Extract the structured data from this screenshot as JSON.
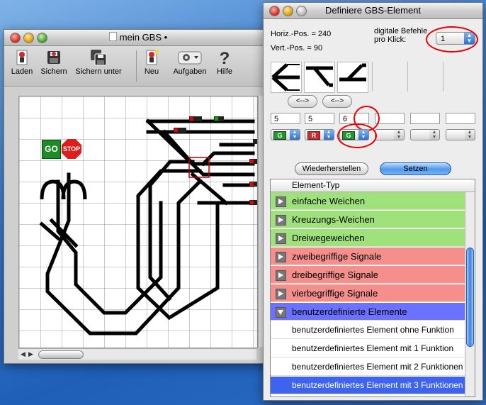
{
  "main_window": {
    "title": "mein GBS",
    "title_dot": "•",
    "toolbar": {
      "laden": "Laden",
      "sichern": "Sichern",
      "sichern_unter": "Sichern unter",
      "neu": "Neu",
      "aufgaben": "Aufgaben",
      "hilfe": "Hilfe"
    },
    "canvas": {
      "go_label": "GO",
      "stop_label": "STOP"
    }
  },
  "dialog": {
    "title": "Definiere GBS-Element",
    "horiz_pos": "Horiz.-Pos. = 240",
    "vert_pos": "Vert.-Pos. = 90",
    "digital_label_line1": "digitale Befehle",
    "digital_label_line2": "pro Klick:",
    "digital_value": "1",
    "swap_label": "<-->",
    "fields": [
      "5",
      "5",
      "6",
      "",
      "",
      ""
    ],
    "signals": [
      {
        "label": "G",
        "color": "#1e9a2a"
      },
      {
        "label": "R",
        "color": "#d9262a"
      },
      {
        "label": "G",
        "color": "#1e9a2a"
      }
    ],
    "btn_restore": "Wiederherstellen",
    "btn_set": "Setzen",
    "list_header": "Element-Typ",
    "categories": [
      {
        "label": "einfache Weichen",
        "color": "green"
      },
      {
        "label": "Kreuzungs-Weichen",
        "color": "green"
      },
      {
        "label": "Dreiwegeweichen",
        "color": "green"
      },
      {
        "label": "zweibegriffige Signale",
        "color": "red"
      },
      {
        "label": "dreibegriffige Signale",
        "color": "red"
      },
      {
        "label": "vierbegriffige Signale",
        "color": "red"
      },
      {
        "label": "benutzerdefinierte Elemente",
        "color": "blue"
      }
    ],
    "items": [
      "benutzerdefiniertes Element ohne Funktion",
      "benutzerdefiniertes Element mit 1 Funktion",
      "benutzerdefiniertes Element mit 2 Funktionen",
      "benutzerdefiniertes Element mit 3 Funktionen"
    ]
  },
  "colors": {
    "highlight_red": "#e00000",
    "selection_blue": "#3e63ee",
    "category_green": "#9fe27b",
    "category_red": "#f48f8c",
    "category_blue": "#6a72ff"
  }
}
